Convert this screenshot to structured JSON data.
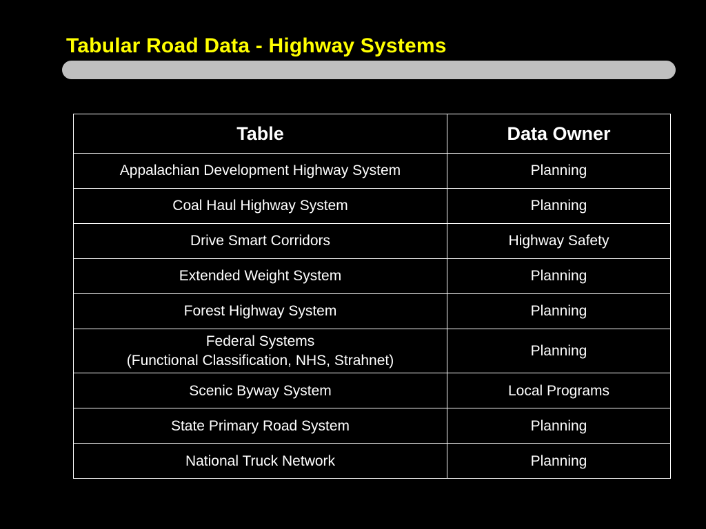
{
  "slide": {
    "title": "Tabular Road Data - Highway Systems",
    "title_color": "#ffff00",
    "bar_color": "#c0c0c0",
    "background_color": "#000000"
  },
  "table": {
    "headers": [
      "Table",
      "Data Owner"
    ],
    "rows": [
      {
        "table": "Appalachian Development Highway System",
        "owner": "Planning"
      },
      {
        "table": "Coal Haul Highway System",
        "owner": "Planning"
      },
      {
        "table": "Drive Smart Corridors",
        "owner": "Highway Safety"
      },
      {
        "table": "Extended Weight System",
        "owner": "Planning"
      },
      {
        "table": "Forest Highway System",
        "owner": "Planning"
      },
      {
        "table": "Federal Systems",
        "table_line2": "(Functional Classification, NHS, Strahnet)",
        "owner": "Planning"
      },
      {
        "table": "Scenic Byway System",
        "owner": "Local Programs"
      },
      {
        "table": "State Primary Road System",
        "owner": "Planning"
      },
      {
        "table": "National Truck Network",
        "owner": "Planning"
      }
    ]
  }
}
